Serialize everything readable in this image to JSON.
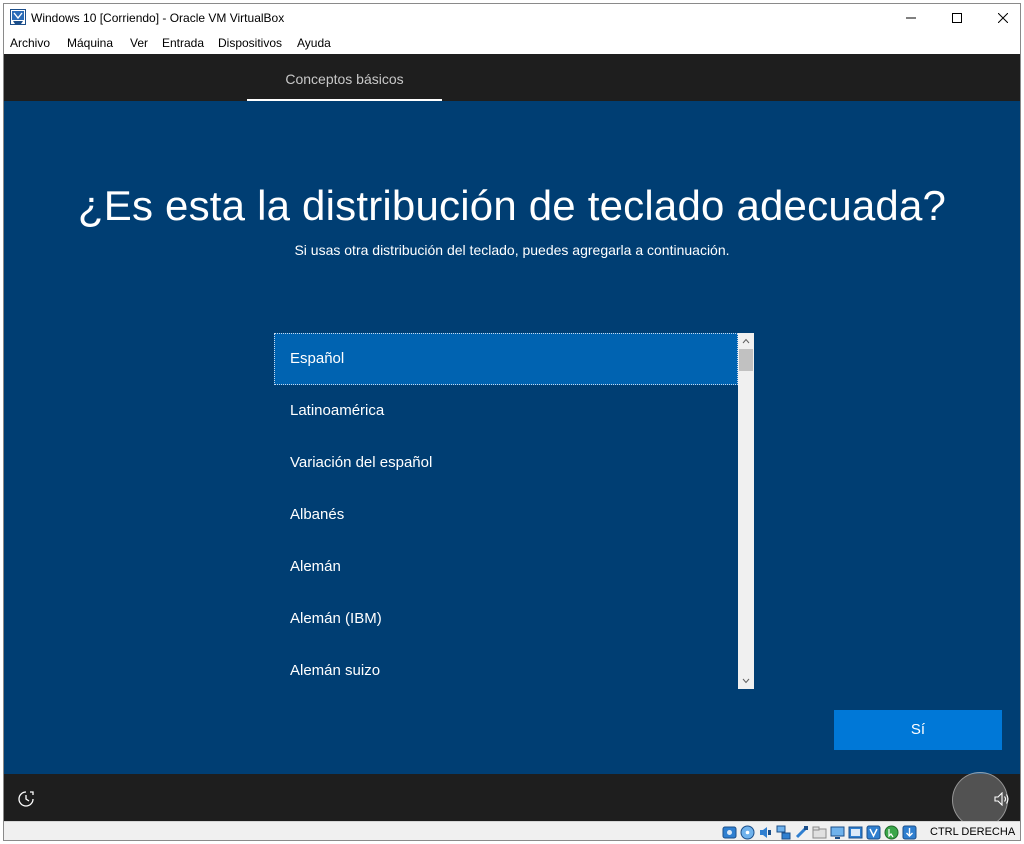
{
  "window": {
    "title": "Windows 10 [Corriendo] - Oracle VM VirtualBox",
    "minimize_glyph": "—",
    "maximize_glyph": "☐",
    "close_glyph": "✕"
  },
  "menu": {
    "items": [
      "Archivo",
      "Máquina",
      "Ver",
      "Entrada",
      "Dispositivos",
      "Ayuda"
    ]
  },
  "setup": {
    "tab_label": "Conceptos básicos",
    "heading": "¿Es esta la distribución de teclado adecuada?",
    "subheading": "Si usas otra distribución del teclado, puedes agregarla a continuación.",
    "layouts": [
      "Español",
      "Latinoamérica",
      "Variación del español",
      "Albanés",
      "Alemán",
      "Alemán (IBM)",
      "Alemán suizo"
    ],
    "selected_index": 0,
    "yes_button": "Sí"
  },
  "statusbar": {
    "host_key": "CTRL DERECHA",
    "icons": [
      "hard-disk-icon",
      "optical-drive-icon",
      "audio-icon",
      "network-icon",
      "usb-icon",
      "shared-folders-icon",
      "display-icon",
      "video-capture-icon",
      "virtualization-icon",
      "mouse-integration-icon",
      "keyboard-capture-icon"
    ]
  },
  "colors": {
    "vm_background": "#003e73",
    "selected_item": "#0063b1",
    "primary_button": "#0078d7",
    "bar_dark": "#1e1e1e"
  }
}
